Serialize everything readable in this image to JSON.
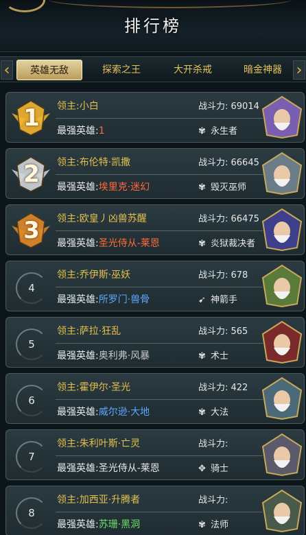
{
  "header": {
    "title": "排行榜"
  },
  "tabs": [
    {
      "label": "英雄无敌",
      "active": true
    },
    {
      "label": "探索之王",
      "active": false
    },
    {
      "label": "大开杀戒",
      "active": false
    },
    {
      "label": "暗金神器",
      "active": false
    }
  ],
  "colors": {
    "gold_text": "#e2c04e",
    "red_hero": "#ff6a3a",
    "blue_hero": "#5aa7ff",
    "green_hero": "#6ee06a",
    "gray_hero": "#c8c8c8"
  },
  "rows": [
    {
      "rank": "1",
      "lord": "领主:小白",
      "hero_prefix": "最强英雄:",
      "hero": "1",
      "hero_color": "#ff6a3a",
      "power": "战斗力: 69014",
      "class_icon": "claw-icon",
      "class": "永生者",
      "medal": "gold"
    },
    {
      "rank": "2",
      "lord": "领主:布伦特·凯撒",
      "hero_prefix": "最强英雄:",
      "hero": "埃里克·迷幻",
      "hero_color": "#ff6a3a",
      "power": "战斗力: 66645",
      "class_icon": "claw-icon",
      "class": "毁灭巫师",
      "medal": "silver"
    },
    {
      "rank": "3",
      "lord": "领主:欧皇丿凶兽苏醒",
      "hero_prefix": "最强英雄:",
      "hero": "圣光侍从-莱恩",
      "hero_color": "#ff6a3a",
      "power": "战斗力: 66475",
      "class_icon": "claw-icon",
      "class": "炎狱裁决者",
      "medal": "bronze"
    },
    {
      "rank": "4",
      "lord": "领主:乔伊斯·巫妖",
      "hero_prefix": "最强英雄:",
      "hero": "所罗门·兽骨",
      "hero_color": "#5aa7ff",
      "power": "战斗力: 678",
      "class_icon": "bow-icon",
      "class": "神箭手",
      "medal": "ring"
    },
    {
      "rank": "5",
      "lord": "领主:萨拉·狂乱",
      "hero_prefix": "最强英雄:",
      "hero": "奥利弗·风暴",
      "hero_color": "#c8c8c8",
      "power": "战斗力: 565",
      "class_icon": "claw-icon",
      "class": "术士",
      "medal": "ring"
    },
    {
      "rank": "6",
      "lord": "领主:霍伊尔·圣光",
      "hero_prefix": "最强英雄:",
      "hero": "威尔逊·大地",
      "hero_color": "#5aa7ff",
      "power": "战斗力: 422",
      "class_icon": "claw-icon",
      "class": "大法",
      "medal": "ring"
    },
    {
      "rank": "7",
      "lord": "领主:朱利叶斯·亡灵",
      "hero_prefix": "最强英雄:",
      "hero": "圣光侍从-莱恩",
      "hero_color": "#e8e8e8",
      "power": "战斗力:",
      "class_icon": "wing-icon",
      "class": "骑士",
      "medal": "ring"
    },
    {
      "rank": "8",
      "lord": "领主:加西亚·升腾者",
      "hero_prefix": "最强英雄:",
      "hero": "苏珊·黑洞",
      "hero_color": "#6ee06a",
      "power": "战斗力:",
      "class_icon": "claw-icon",
      "class": "法师",
      "medal": "ring"
    }
  ]
}
